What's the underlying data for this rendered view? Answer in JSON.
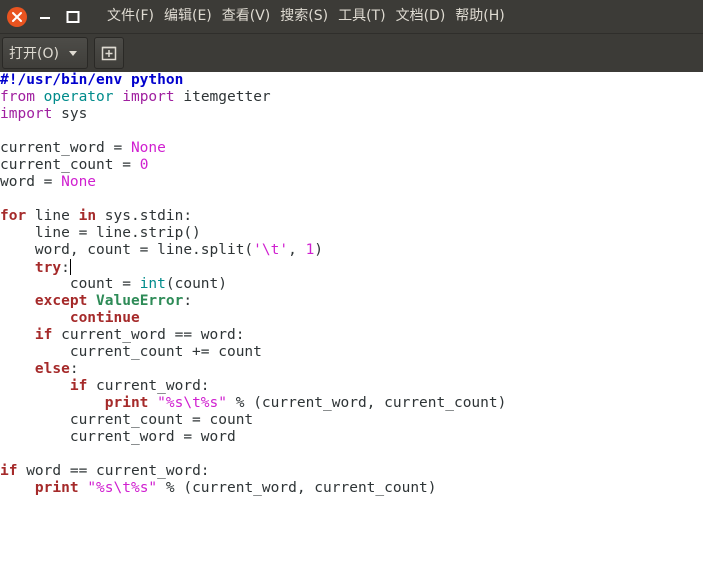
{
  "window": {
    "controls": {
      "close_icon": "close-icon",
      "minimize_icon": "minimize-icon",
      "maximize_icon": "maximize-icon"
    }
  },
  "menu": [
    {
      "label": "文件(F)"
    },
    {
      "label": "编辑(E)"
    },
    {
      "label": "查看(V)"
    },
    {
      "label": "搜索(S)"
    },
    {
      "label": "工具(T)"
    },
    {
      "label": "文档(D)"
    },
    {
      "label": "帮助(H)"
    }
  ],
  "toolbar": {
    "open_label": "打开(O)",
    "new_icon": "new-document-icon"
  },
  "colors": {
    "close_button": "#e95420",
    "chrome": "#3c3b37",
    "editor_bg": "#ffffff"
  },
  "editor": {
    "lines": [
      [
        {
          "t": "#!/usr/bin/env python",
          "c": "shebang"
        }
      ],
      [
        {
          "t": "from",
          "c": "kw"
        },
        {
          "t": " ",
          "c": "txt"
        },
        {
          "t": "operator",
          "c": "mod"
        },
        {
          "t": " ",
          "c": "txt"
        },
        {
          "t": "import",
          "c": "kw"
        },
        {
          "t": " itemgetter",
          "c": "txt"
        }
      ],
      [
        {
          "t": "import",
          "c": "kw"
        },
        {
          "t": " sys",
          "c": "txt"
        }
      ],
      [],
      [
        {
          "t": "current_word = ",
          "c": "txt"
        },
        {
          "t": "None",
          "c": "const"
        }
      ],
      [
        {
          "t": "current_count = ",
          "c": "txt"
        },
        {
          "t": "0",
          "c": "const"
        }
      ],
      [
        {
          "t": "word = ",
          "c": "txt"
        },
        {
          "t": "None",
          "c": "const"
        }
      ],
      [],
      [
        {
          "t": "for",
          "c": "kwb"
        },
        {
          "t": " line ",
          "c": "txt"
        },
        {
          "t": "in",
          "c": "kwb"
        },
        {
          "t": " sys.stdin:",
          "c": "txt"
        }
      ],
      [
        {
          "t": "    line = line.strip()",
          "c": "txt"
        }
      ],
      [
        {
          "t": "    word, count = line.split(",
          "c": "txt"
        },
        {
          "t": "'\\t'",
          "c": "str"
        },
        {
          "t": ", ",
          "c": "txt"
        },
        {
          "t": "1",
          "c": "const"
        },
        {
          "t": ")",
          "c": "txt"
        }
      ],
      [
        {
          "t": "    ",
          "c": "txt"
        },
        {
          "t": "try",
          "c": "kwb"
        },
        {
          "t": ":",
          "c": "txt"
        },
        {
          "t": "",
          "c": "cursor"
        }
      ],
      [
        {
          "t": "        count = ",
          "c": "txt"
        },
        {
          "t": "int",
          "c": "builtin"
        },
        {
          "t": "(count)",
          "c": "txt"
        }
      ],
      [
        {
          "t": "    ",
          "c": "txt"
        },
        {
          "t": "except",
          "c": "kwb"
        },
        {
          "t": " ",
          "c": "txt"
        },
        {
          "t": "ValueError",
          "c": "exc"
        },
        {
          "t": ":",
          "c": "txt"
        }
      ],
      [
        {
          "t": "        ",
          "c": "txt"
        },
        {
          "t": "continue",
          "c": "kwb"
        }
      ],
      [
        {
          "t": "    ",
          "c": "txt"
        },
        {
          "t": "if",
          "c": "kwb"
        },
        {
          "t": " current_word == word:",
          "c": "txt"
        }
      ],
      [
        {
          "t": "        current_count += count",
          "c": "txt"
        }
      ],
      [
        {
          "t": "    ",
          "c": "txt"
        },
        {
          "t": "else",
          "c": "kwb"
        },
        {
          "t": ":",
          "c": "txt"
        }
      ],
      [
        {
          "t": "        ",
          "c": "txt"
        },
        {
          "t": "if",
          "c": "kwb"
        },
        {
          "t": " current_word:",
          "c": "txt"
        }
      ],
      [
        {
          "t": "            ",
          "c": "txt"
        },
        {
          "t": "print",
          "c": "kwb"
        },
        {
          "t": " ",
          "c": "txt"
        },
        {
          "t": "\"%s\\t%s\"",
          "c": "str"
        },
        {
          "t": " % (current_word, current_count)",
          "c": "txt"
        }
      ],
      [
        {
          "t": "        current_count = count",
          "c": "txt"
        }
      ],
      [
        {
          "t": "        current_word = word",
          "c": "txt"
        }
      ],
      [],
      [
        {
          "t": "if",
          "c": "kwb"
        },
        {
          "t": " word == current_word:",
          "c": "txt"
        }
      ],
      [
        {
          "t": "    ",
          "c": "txt"
        },
        {
          "t": "print",
          "c": "kwb"
        },
        {
          "t": " ",
          "c": "txt"
        },
        {
          "t": "\"%s\\t%s\"",
          "c": "str"
        },
        {
          "t": " % (current_word, current_count)",
          "c": "txt"
        }
      ]
    ]
  }
}
